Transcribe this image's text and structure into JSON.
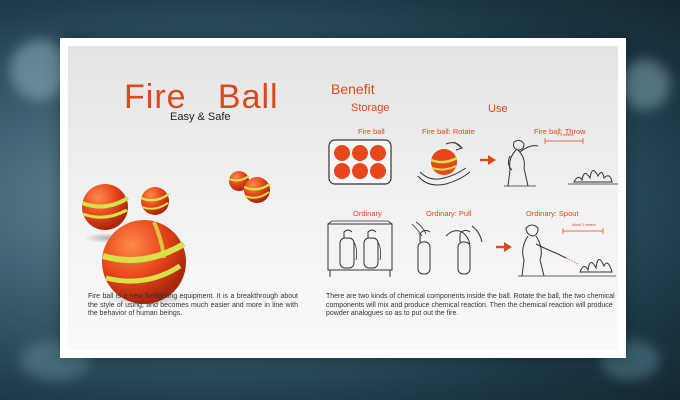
{
  "product": {
    "title": "Fire   Ball",
    "subtitle": "Easy & Safe",
    "description": "Fire ball is a new firefighting equipment. It is a breakthrough about the style of using, and becomes much easier and more in line with the behavior of human beings."
  },
  "benefit": {
    "heading": "Benefit",
    "storage_heading": "Storage",
    "use_heading": "Use",
    "labels": {
      "fire_ball": "Fire ball",
      "rotate": "Fire ball: Rotate",
      "throw": "Fire ball: Throw",
      "ordinary": "Ordinary",
      "pull": "Ordinary: Pull",
      "spout": "Ordinary: Spout"
    },
    "distance_tags": {
      "throw": "< 3 meters",
      "spout": "About 2 meters"
    },
    "description": "There are two kinds of chemical components inside the ball. Rotate the ball, the two chemical components will mix and produce chemical reaction. Then the chemical reaction will produce powder analogues so as to put out the fire."
  },
  "colors": {
    "accent": "#d94a1c",
    "ball_orange": "#e8461c",
    "stripe_yellow": "#d7e24a",
    "backdrop": "#2f5260"
  }
}
